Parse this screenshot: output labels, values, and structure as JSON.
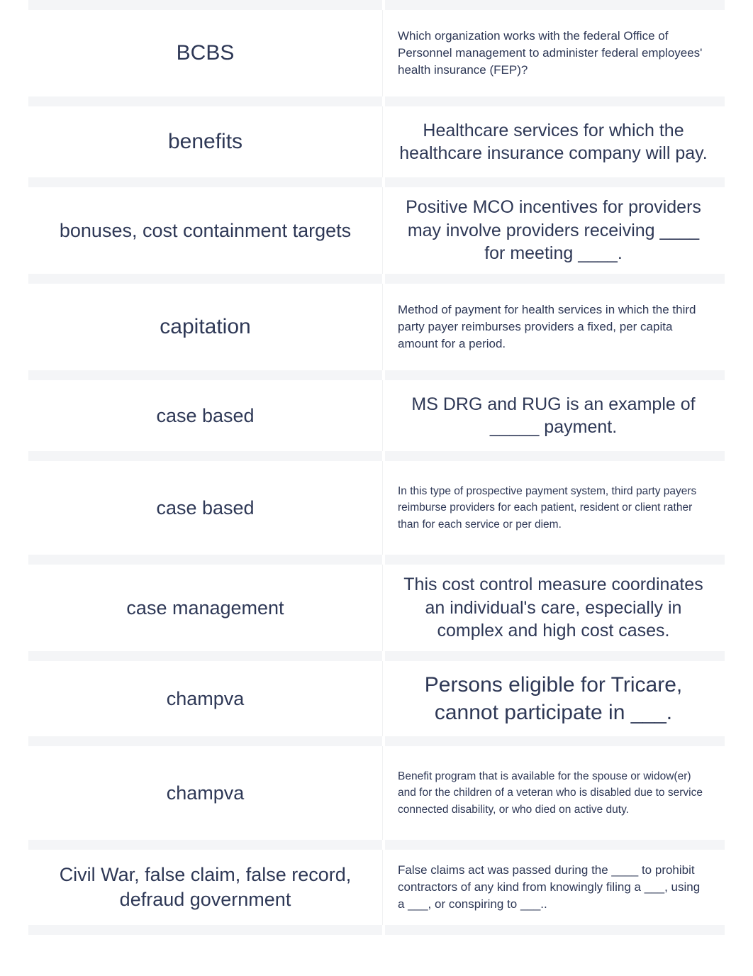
{
  "document": {
    "type": "flashcard-set-print",
    "column_headers": [
      "term",
      "definition"
    ],
    "text_color": "#2e3856",
    "separator_color": "#f4f5f7",
    "page_background": "#ffffff"
  },
  "cards": [
    {
      "term": "BCBS",
      "definition": "Which organization works with the federal Office of Personnel management to administer federal employees' health insurance (FEP)?",
      "term_size": "sz-xl",
      "def_size": "sz-sm",
      "def_align": "align-left",
      "height": "h-122"
    },
    {
      "term": "benefits",
      "definition": "Healthcare services for which the healthcare insurance company will pay.",
      "term_size": "sz-xl",
      "def_size": "sz-md",
      "def_align": "align-center",
      "height": "h-100"
    },
    {
      "term": "bonuses, cost containment targets",
      "definition": "Positive MCO incentives for providers may involve providers receiving ____ for meeting ____.",
      "term_size": "sz-lg",
      "def_size": "sz-md",
      "def_align": "align-center",
      "height": "h-122"
    },
    {
      "term": "capitation",
      "definition": "Method of payment for health services in which the third party payer reimburses providers a fixed, per capita amount for a period.",
      "term_size": "sz-xl",
      "def_size": "sz-sm",
      "def_align": "align-left",
      "height": "h-122"
    },
    {
      "term": "case based",
      "definition": "MS DRG and RUG is an example of _____ payment.",
      "term_size": "sz-lg",
      "def_size": "sz-md",
      "def_align": "align-center",
      "height": "h-100"
    },
    {
      "term": "case based",
      "definition": "In this type of prospective payment system, third party payers reimburse providers for each patient, resident or client rather than for each service or per diem.",
      "term_size": "sz-lg",
      "def_size": "sz-xs",
      "def_align": "align-left",
      "height": "h-132"
    },
    {
      "term": "case management",
      "definition": "This cost control measure coordinates an individual's care, especially in complex and high cost cases.",
      "term_size": "sz-lg",
      "def_size": "sz-md",
      "def_align": "align-center",
      "height": "h-122"
    },
    {
      "term": "champva",
      "definition": "Persons eligible for Tricare, cannot participate in ___.",
      "term_size": "sz-lg",
      "def_size": "sz-xl",
      "def_align": "align-center",
      "height": "h-106"
    },
    {
      "term": "champva",
      "definition": "Benefit program that is available for the spouse or widow(er) and for the children of a veteran who is disabled due to service connected disability, or who died on active duty.",
      "term_size": "sz-lg",
      "def_size": "sz-xs",
      "def_align": "align-left",
      "height": "h-132"
    },
    {
      "term": "Civil War, false claim, false record, defraud government",
      "definition": "False claims act was passed during the ____ to prohibit contractors of any kind from knowingly filing a ___, using a ___, or conspiring to ___..",
      "term_size": "sz-lg",
      "def_size": "sz-sm",
      "def_align": "align-left",
      "height": "h-106"
    }
  ]
}
